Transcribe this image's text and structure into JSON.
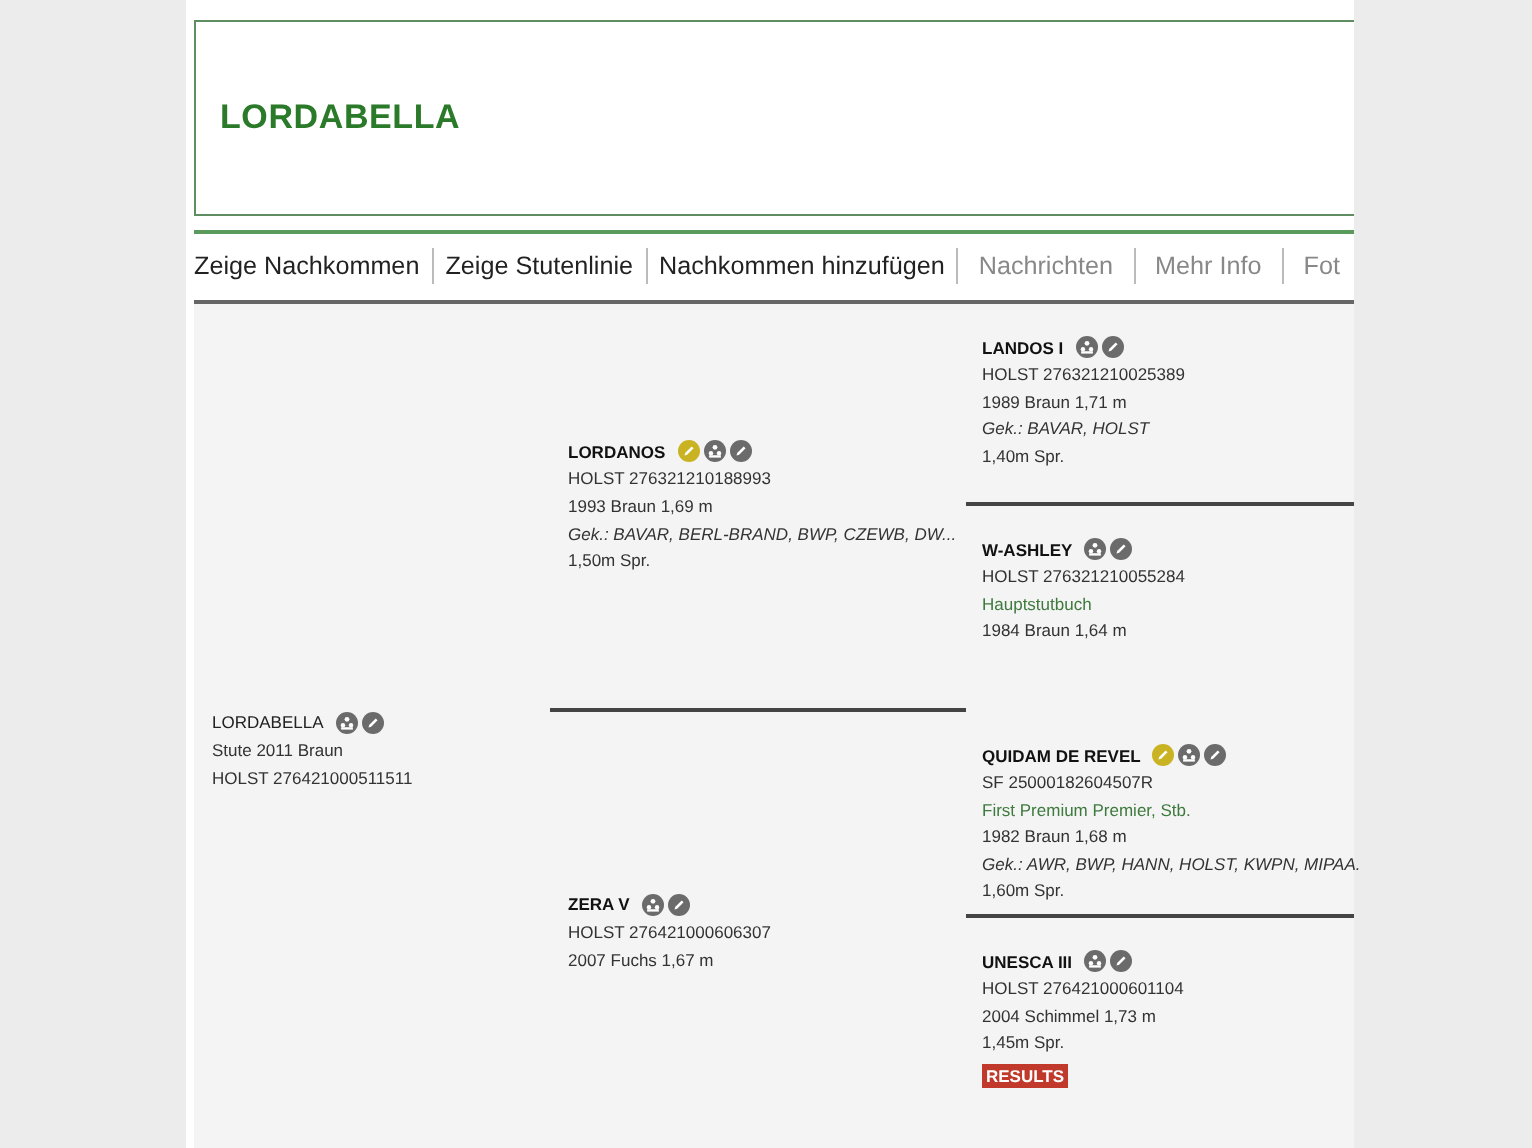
{
  "title": "LORDABELLA",
  "tabs": [
    {
      "label": "Zeige Nachkommen",
      "disabled": false
    },
    {
      "label": "Zeige Stutenlinie",
      "disabled": false
    },
    {
      "label": "Nachkommen hinzufügen",
      "disabled": false
    },
    {
      "label": "Nachrichten",
      "disabled": true
    },
    {
      "label": "Mehr Info",
      "disabled": true
    },
    {
      "label": "Fot",
      "disabled": true
    }
  ],
  "pedigree": {
    "horse": {
      "name": "LORDABELLA",
      "icons": [
        {
          "kind": "pedigree"
        },
        {
          "kind": "edit"
        }
      ],
      "lines": [
        {
          "kind": "plain",
          "text": "Stute 2011 Braun"
        },
        {
          "kind": "plain",
          "text": "HOLST 276421000511511"
        }
      ]
    },
    "parents": [
      {
        "name": "LORDANOS",
        "icons": [
          {
            "kind": "premium"
          },
          {
            "kind": "pedigree"
          },
          {
            "kind": "edit"
          }
        ],
        "lines": [
          {
            "kind": "plain",
            "text": "HOLST 276321210188993"
          },
          {
            "kind": "plain",
            "text": "1993 Braun 1,69 m"
          },
          {
            "kind": "italic",
            "text": "Gek.: BAVAR, BERL-BRAND, BWP, CZEWB, DW..."
          },
          {
            "kind": "plain",
            "text": "1,50m Spr."
          }
        ]
      },
      {
        "name": "ZERA V",
        "icons": [
          {
            "kind": "pedigree"
          },
          {
            "kind": "edit"
          }
        ],
        "lines": [
          {
            "kind": "plain",
            "text": "HOLST 276421000606307"
          },
          {
            "kind": "plain",
            "text": "2007 Fuchs 1,67 m"
          }
        ]
      }
    ],
    "grandparents": [
      {
        "name": "LANDOS I",
        "icons": [
          {
            "kind": "pedigree"
          },
          {
            "kind": "edit"
          }
        ],
        "lines": [
          {
            "kind": "plain",
            "text": "HOLST 276321210025389"
          },
          {
            "kind": "plain",
            "text": "1989 Braun 1,71 m"
          },
          {
            "kind": "italic",
            "text": "Gek.: BAVAR, HOLST"
          },
          {
            "kind": "plain",
            "text": "1,40m Spr."
          }
        ]
      },
      {
        "name": "W-ASHLEY",
        "icons": [
          {
            "kind": "pedigree"
          },
          {
            "kind": "edit"
          }
        ],
        "lines": [
          {
            "kind": "plain",
            "text": "HOLST 276321210055284"
          },
          {
            "kind": "green",
            "text": "Hauptstutbuch"
          },
          {
            "kind": "plain",
            "text": "1984 Braun 1,64 m"
          }
        ]
      },
      {
        "name": "QUIDAM DE REVEL",
        "icons": [
          {
            "kind": "premium"
          },
          {
            "kind": "pedigree"
          },
          {
            "kind": "edit"
          }
        ],
        "lines": [
          {
            "kind": "plain",
            "text": "SF 25000182604507R"
          },
          {
            "kind": "green",
            "text": "First Premium Premier, Stb."
          },
          {
            "kind": "plain",
            "text": "1982 Braun 1,68 m"
          },
          {
            "kind": "italic",
            "text": "Gek.: AWR, BWP, HANN, HOLST, KWPN, MIPAA."
          },
          {
            "kind": "plain",
            "text": "1,60m Spr."
          }
        ]
      },
      {
        "name": "UNESCA III",
        "icons": [
          {
            "kind": "pedigree"
          },
          {
            "kind": "edit"
          }
        ],
        "lines": [
          {
            "kind": "plain",
            "text": "HOLST 276421000601104"
          },
          {
            "kind": "plain",
            "text": "2004 Schimmel 1,73 m"
          },
          {
            "kind": "plain",
            "text": "1,45m Spr."
          }
        ],
        "badge": "RESULTS"
      }
    ]
  }
}
